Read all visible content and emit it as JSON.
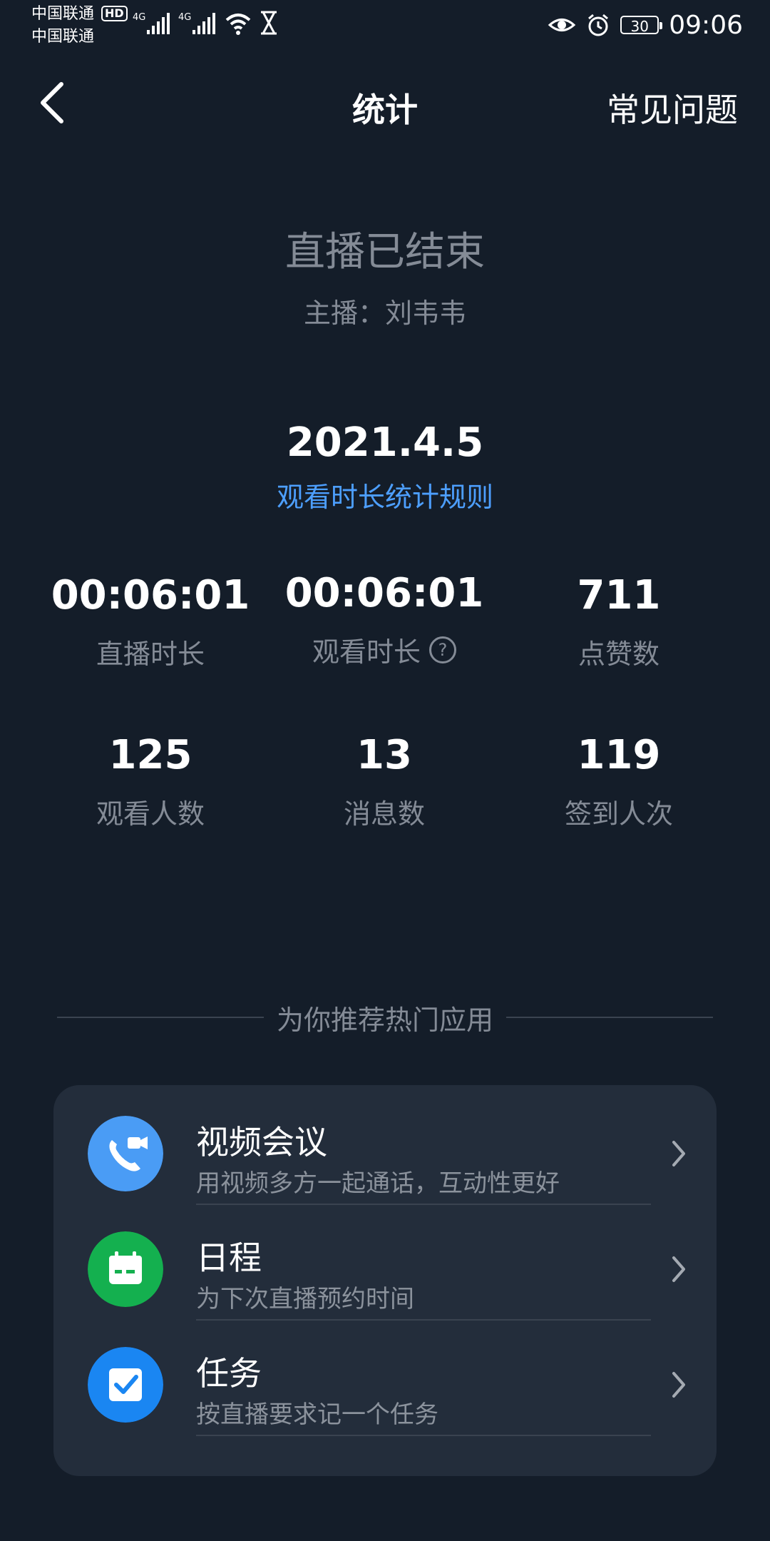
{
  "status_bar": {
    "carrier1": "中国联通",
    "carrier2": "中国联通",
    "hd": "HD",
    "net1": "4G",
    "net2": "4G",
    "battery": "30",
    "time": "09:06"
  },
  "header": {
    "title": "统计",
    "faq_label": "常见问题"
  },
  "summary": {
    "ended": "直播已结束",
    "host": "主播：刘韦韦",
    "date": "2021.4.5",
    "rule_link": "观看时长统计规则"
  },
  "stats": [
    {
      "value": "00:06:01",
      "label": "直播时长"
    },
    {
      "value": "00:06:01",
      "label": "观看时长"
    },
    {
      "value": "711",
      "label": "点赞数"
    },
    {
      "value": "125",
      "label": "观看人数"
    },
    {
      "value": "13",
      "label": "消息数"
    },
    {
      "value": "119",
      "label": "签到人次"
    }
  ],
  "recommend": {
    "heading": "为你推荐热门应用",
    "apps": [
      {
        "name": "视频会议",
        "desc": "用视频多方一起通话，互动性更好",
        "icon": "video-call-icon",
        "color": "#4a9cf5"
      },
      {
        "name": "日程",
        "desc": "为下次直播预约时间",
        "icon": "calendar-icon",
        "color": "#14b04f"
      },
      {
        "name": "任务",
        "desc": "按直播要求记一个任务",
        "icon": "task-check-icon",
        "color": "#1a86f2"
      }
    ]
  },
  "colors": {
    "background": "#141d29",
    "card": "#232d3b",
    "link": "#4d9fff",
    "muted": "#848b96"
  }
}
